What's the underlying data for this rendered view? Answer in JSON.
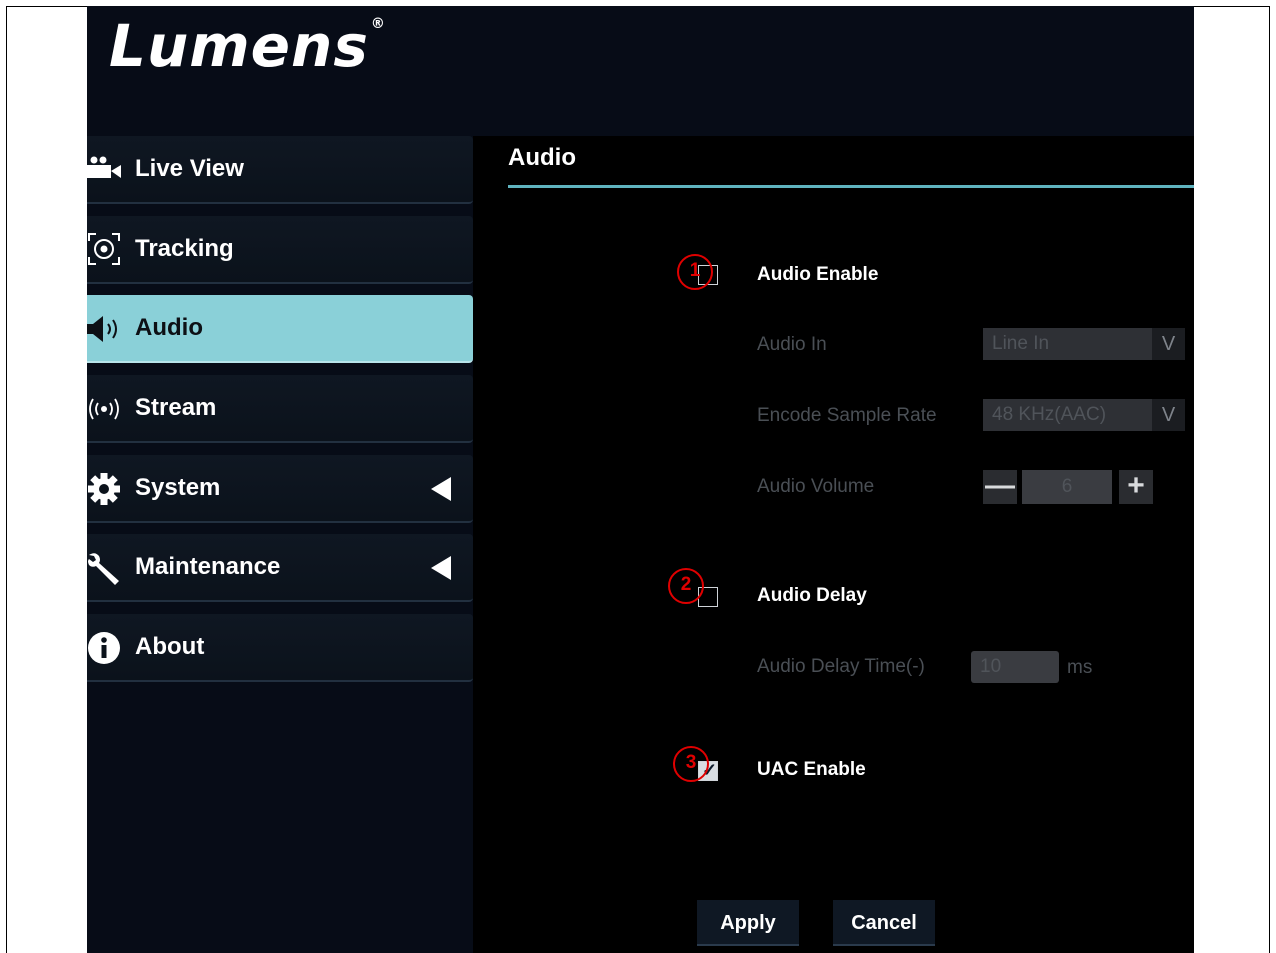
{
  "brand": {
    "logo_text": "Lumens",
    "registered_mark": "®"
  },
  "sidebar": {
    "items": [
      {
        "label": "Live View",
        "icon": "video-camera-icon",
        "active": false,
        "has_submenu": false
      },
      {
        "label": "Tracking",
        "icon": "tracking-target-icon",
        "active": false,
        "has_submenu": false
      },
      {
        "label": "Audio",
        "icon": "speaker-icon",
        "active": true,
        "has_submenu": false
      },
      {
        "label": "Stream",
        "icon": "broadcast-icon",
        "active": false,
        "has_submenu": false
      },
      {
        "label": "System",
        "icon": "gear-icon",
        "active": false,
        "has_submenu": true
      },
      {
        "label": "Maintenance",
        "icon": "wrench-icon",
        "active": false,
        "has_submenu": true
      },
      {
        "label": "About",
        "icon": "info-icon",
        "active": false,
        "has_submenu": false
      }
    ]
  },
  "main": {
    "title": "Audio",
    "audio_enable": {
      "label": "Audio Enable",
      "checked": false,
      "marker": "1"
    },
    "audio_in": {
      "label": "Audio In",
      "value": "Line In",
      "arrow": "V"
    },
    "encode_sample_rate": {
      "label": "Encode Sample Rate",
      "value": "48 KHz(AAC)",
      "arrow": "V"
    },
    "audio_volume": {
      "label": "Audio Volume",
      "value": "6",
      "minus": "—",
      "plus": "+"
    },
    "audio_delay": {
      "label": "Audio Delay",
      "checked": false,
      "marker": "2"
    },
    "audio_delay_time": {
      "label": "Audio Delay Time(-)",
      "value": "10",
      "unit": "ms"
    },
    "uac_enable": {
      "label": "UAC Enable",
      "checked": true,
      "marker": "3",
      "checkmark": "✓"
    },
    "apply_label": "Apply",
    "cancel_label": "Cancel"
  },
  "colors": {
    "accent": "#8ad0d8",
    "title_rule": "#5fb3bf",
    "annotation": "#e00000",
    "background": "#000000"
  }
}
